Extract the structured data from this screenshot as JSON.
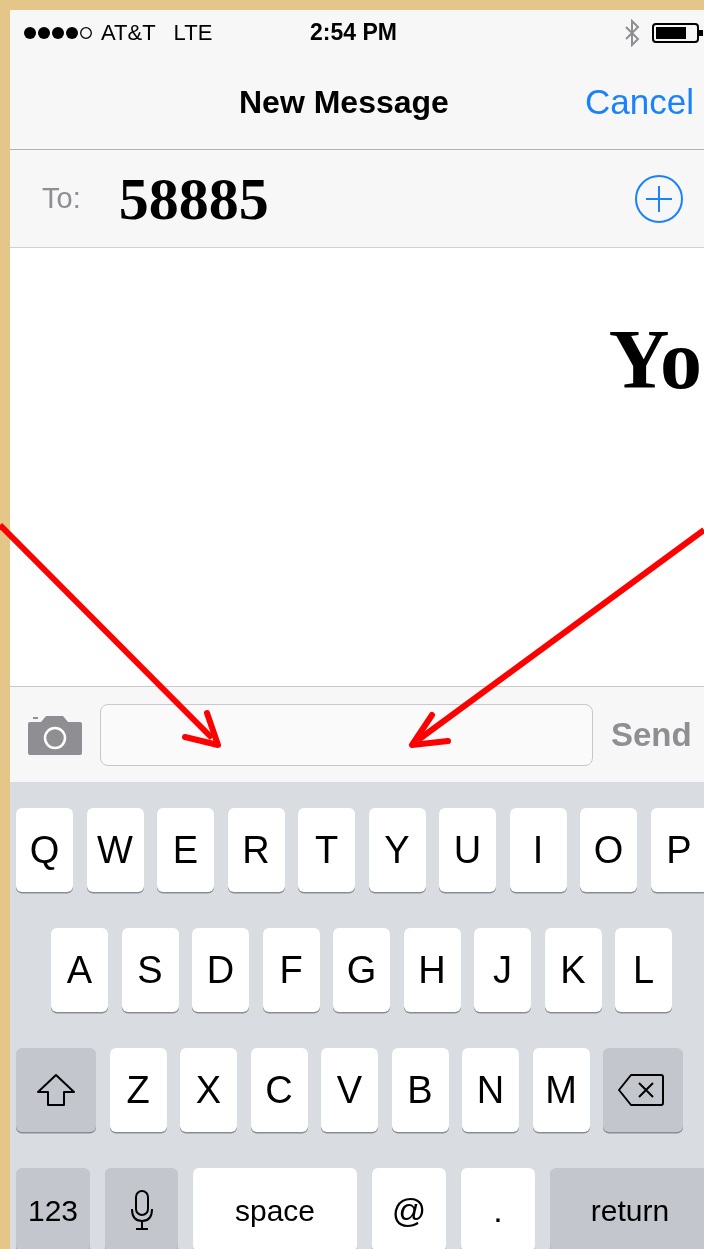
{
  "status_bar": {
    "carrier": "AT&T",
    "network": "LTE",
    "time": "2:54 PM"
  },
  "nav_bar": {
    "title": "New Message",
    "cancel": "Cancel"
  },
  "to_row": {
    "label": "To:",
    "recipient": "58885"
  },
  "message_area": {
    "overlay_text": "Yo"
  },
  "compose_bar": {
    "send": "Send",
    "send_disabled": true
  },
  "keyboard": {
    "rows": [
      {
        "keys": [
          {
            "kind": "letter",
            "label": "Q"
          },
          {
            "kind": "letter",
            "label": "W"
          },
          {
            "kind": "letter",
            "label": "E"
          },
          {
            "kind": "letter",
            "label": "R"
          },
          {
            "kind": "letter",
            "label": "T"
          },
          {
            "kind": "letter",
            "label": "Y"
          },
          {
            "kind": "letter",
            "label": "U"
          },
          {
            "kind": "letter",
            "label": "I"
          },
          {
            "kind": "letter",
            "label": "O"
          },
          {
            "kind": "letter",
            "label": "P"
          }
        ]
      },
      {
        "keys": [
          {
            "kind": "letter",
            "label": "A"
          },
          {
            "kind": "letter",
            "label": "S"
          },
          {
            "kind": "letter",
            "label": "D"
          },
          {
            "kind": "letter",
            "label": "F"
          },
          {
            "kind": "letter",
            "label": "G"
          },
          {
            "kind": "letter",
            "label": "H"
          },
          {
            "kind": "letter",
            "label": "J"
          },
          {
            "kind": "letter",
            "label": "K"
          },
          {
            "kind": "letter",
            "label": "L"
          }
        ]
      },
      {
        "keys": [
          {
            "kind": "shift"
          },
          {
            "kind": "letter",
            "label": "Z"
          },
          {
            "kind": "letter",
            "label": "X"
          },
          {
            "kind": "letter",
            "label": "C"
          },
          {
            "kind": "letter",
            "label": "V"
          },
          {
            "kind": "letter",
            "label": "B"
          },
          {
            "kind": "letter",
            "label": "N"
          },
          {
            "kind": "letter",
            "label": "M"
          },
          {
            "kind": "delete"
          }
        ]
      },
      {
        "keys": [
          {
            "kind": "numbers",
            "label": "123"
          },
          {
            "kind": "mic"
          },
          {
            "kind": "space",
            "label": "space"
          },
          {
            "kind": "symbol",
            "label": "@"
          },
          {
            "kind": "symbol",
            "label": "."
          },
          {
            "kind": "return",
            "label": "return"
          }
        ]
      }
    ]
  }
}
